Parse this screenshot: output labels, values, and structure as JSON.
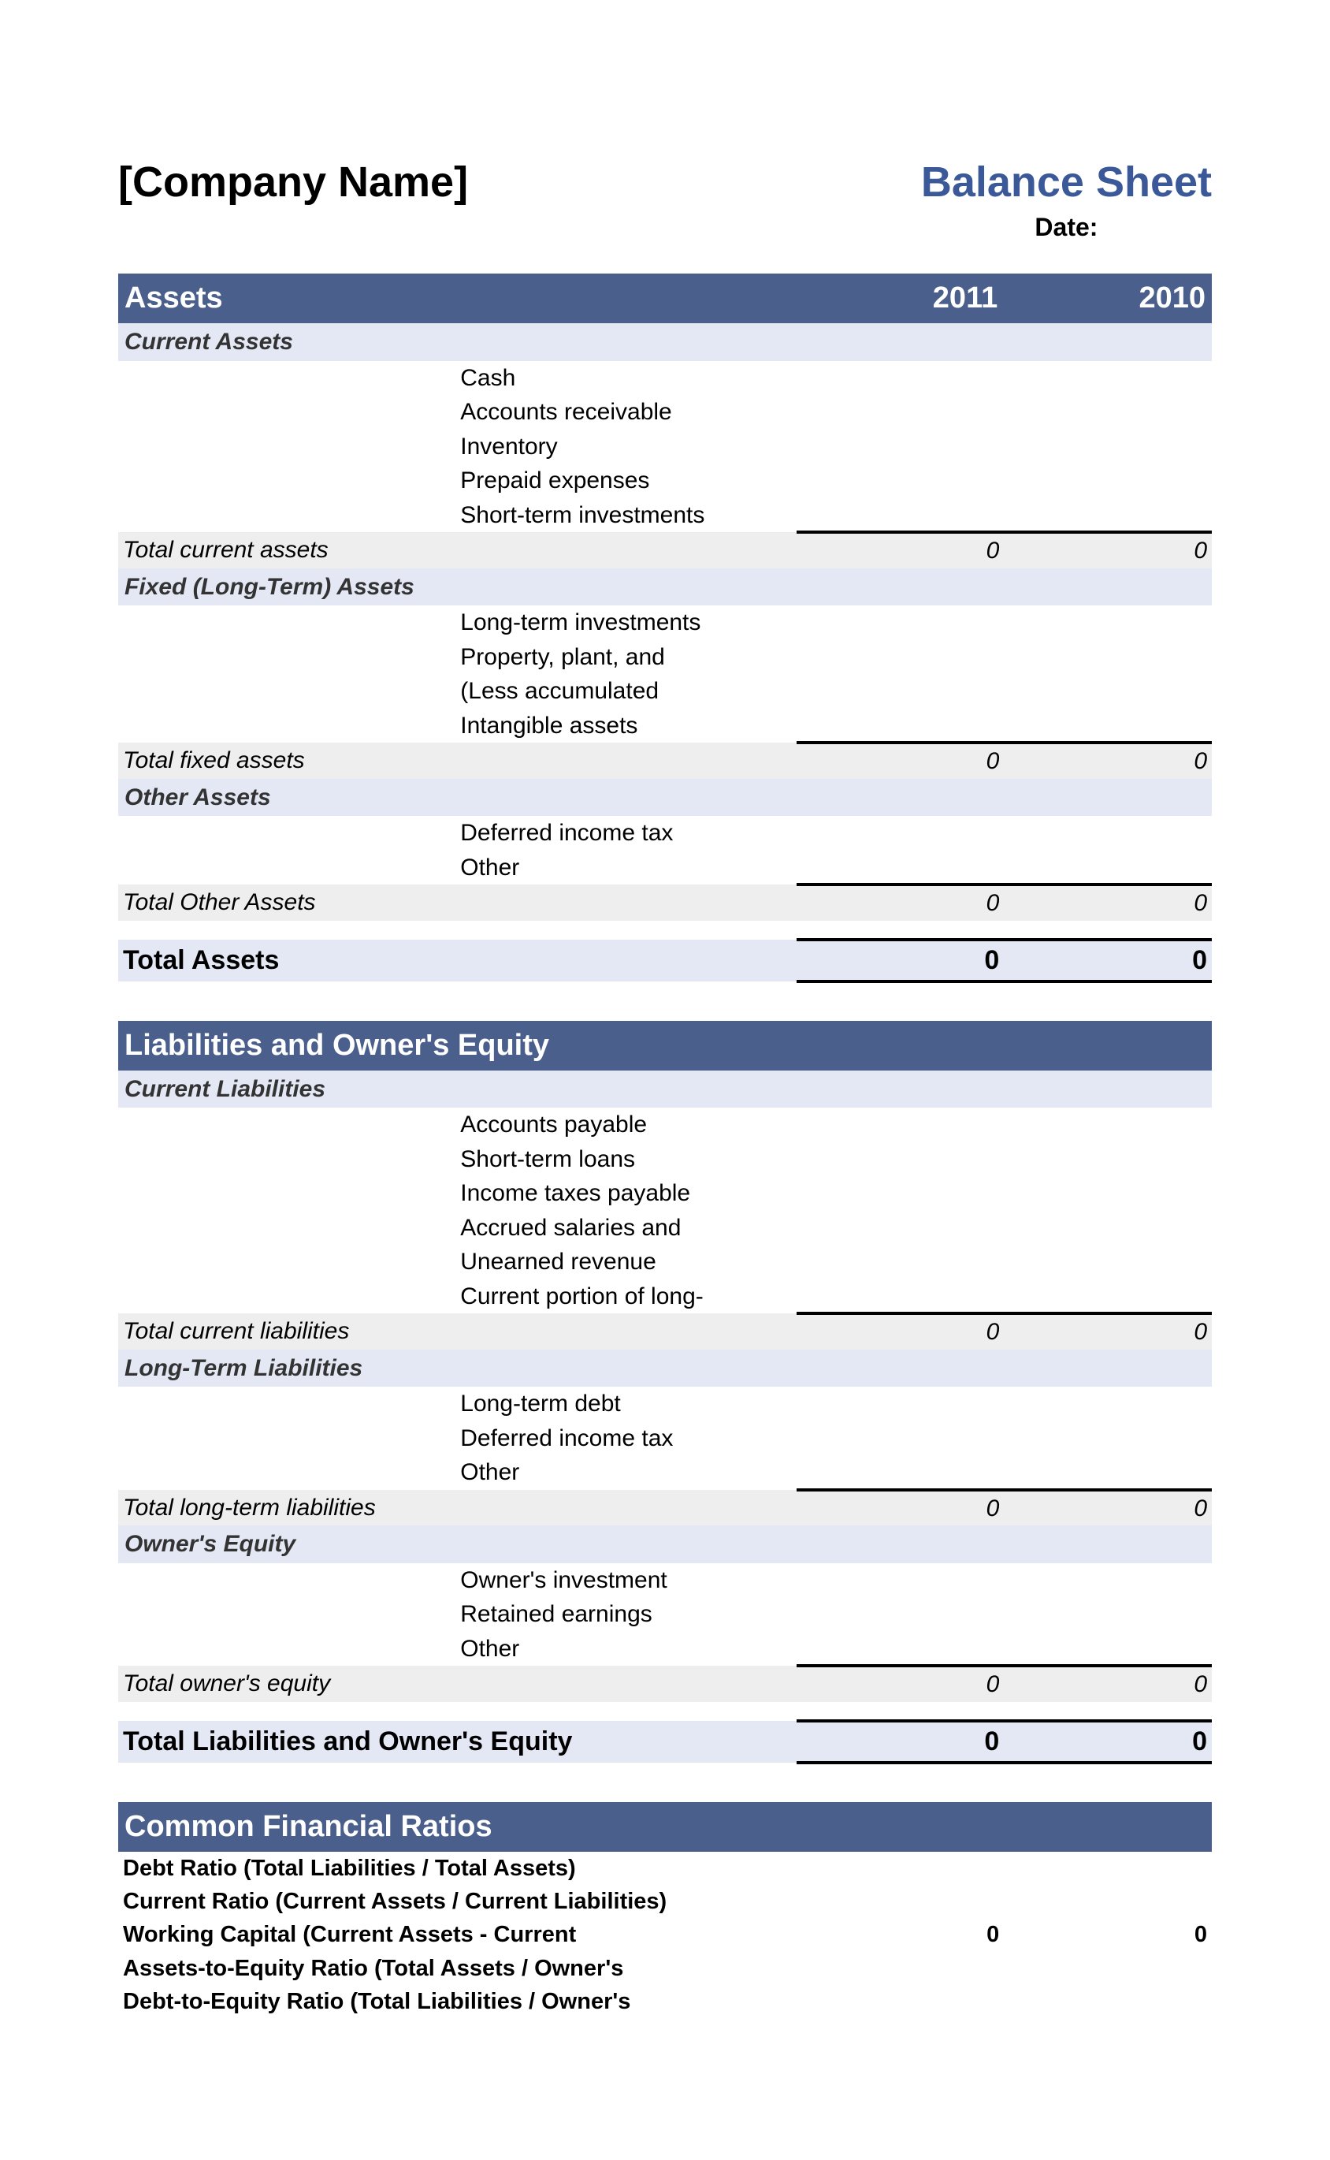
{
  "header": {
    "company": "[Company Name]",
    "title": "Balance Sheet",
    "date_label": "Date:"
  },
  "years": {
    "y1": "2011",
    "y2": "2010"
  },
  "sections": {
    "assets": {
      "heading": "Assets",
      "current": {
        "heading": "Current Assets",
        "items": [
          "Cash",
          "Accounts receivable",
          "Inventory",
          "Prepaid expenses",
          "Short-term investments"
        ],
        "total_label": "Total current assets",
        "total_y1": "0",
        "total_y2": "0"
      },
      "fixed": {
        "heading": "Fixed (Long-Term) Assets",
        "items": [
          "Long-term investments",
          "Property, plant, and",
          "(Less accumulated",
          "Intangible assets"
        ],
        "total_label": "Total fixed assets",
        "total_y1": "0",
        "total_y2": "0"
      },
      "other": {
        "heading": "Other Assets",
        "items": [
          "Deferred income tax",
          "Other"
        ],
        "total_label": "Total Other Assets",
        "total_y1": "0",
        "total_y2": "0"
      },
      "grand_label": "Total Assets",
      "grand_y1": "0",
      "grand_y2": "0"
    },
    "liab": {
      "heading": "Liabilities and Owner's Equity",
      "current": {
        "heading": "Current Liabilities",
        "items": [
          "Accounts payable",
          "Short-term loans",
          "Income taxes payable",
          "Accrued salaries and",
          "Unearned revenue",
          "Current portion of long-"
        ],
        "total_label": "Total current liabilities",
        "total_y1": "0",
        "total_y2": "0"
      },
      "longterm": {
        "heading": "Long-Term Liabilities",
        "items": [
          "Long-term debt",
          "Deferred income tax",
          "Other"
        ],
        "total_label": "Total long-term liabilities",
        "total_y1": "0",
        "total_y2": "0"
      },
      "equity": {
        "heading": "Owner's Equity",
        "items": [
          "Owner's investment",
          "Retained earnings",
          "Other"
        ],
        "total_label": "Total owner's equity",
        "total_y1": "0",
        "total_y2": "0"
      },
      "grand_label": "Total Liabilities and Owner's Equity",
      "grand_y1": "0",
      "grand_y2": "0"
    },
    "ratios": {
      "heading": "Common Financial Ratios",
      "rows": [
        {
          "label": "Debt Ratio (Total Liabilities / Total Assets)",
          "y1": "",
          "y2": ""
        },
        {
          "label": "Current Ratio (Current Assets / Current Liabilities)",
          "y1": "",
          "y2": ""
        },
        {
          "label": "Working Capital (Current Assets - Current",
          "y1": "0",
          "y2": "0"
        },
        {
          "label": "Assets-to-Equity Ratio (Total Assets / Owner's",
          "y1": "",
          "y2": ""
        },
        {
          "label": "Debt-to-Equity Ratio (Total Liabilities / Owner's",
          "y1": "",
          "y2": ""
        }
      ]
    }
  }
}
